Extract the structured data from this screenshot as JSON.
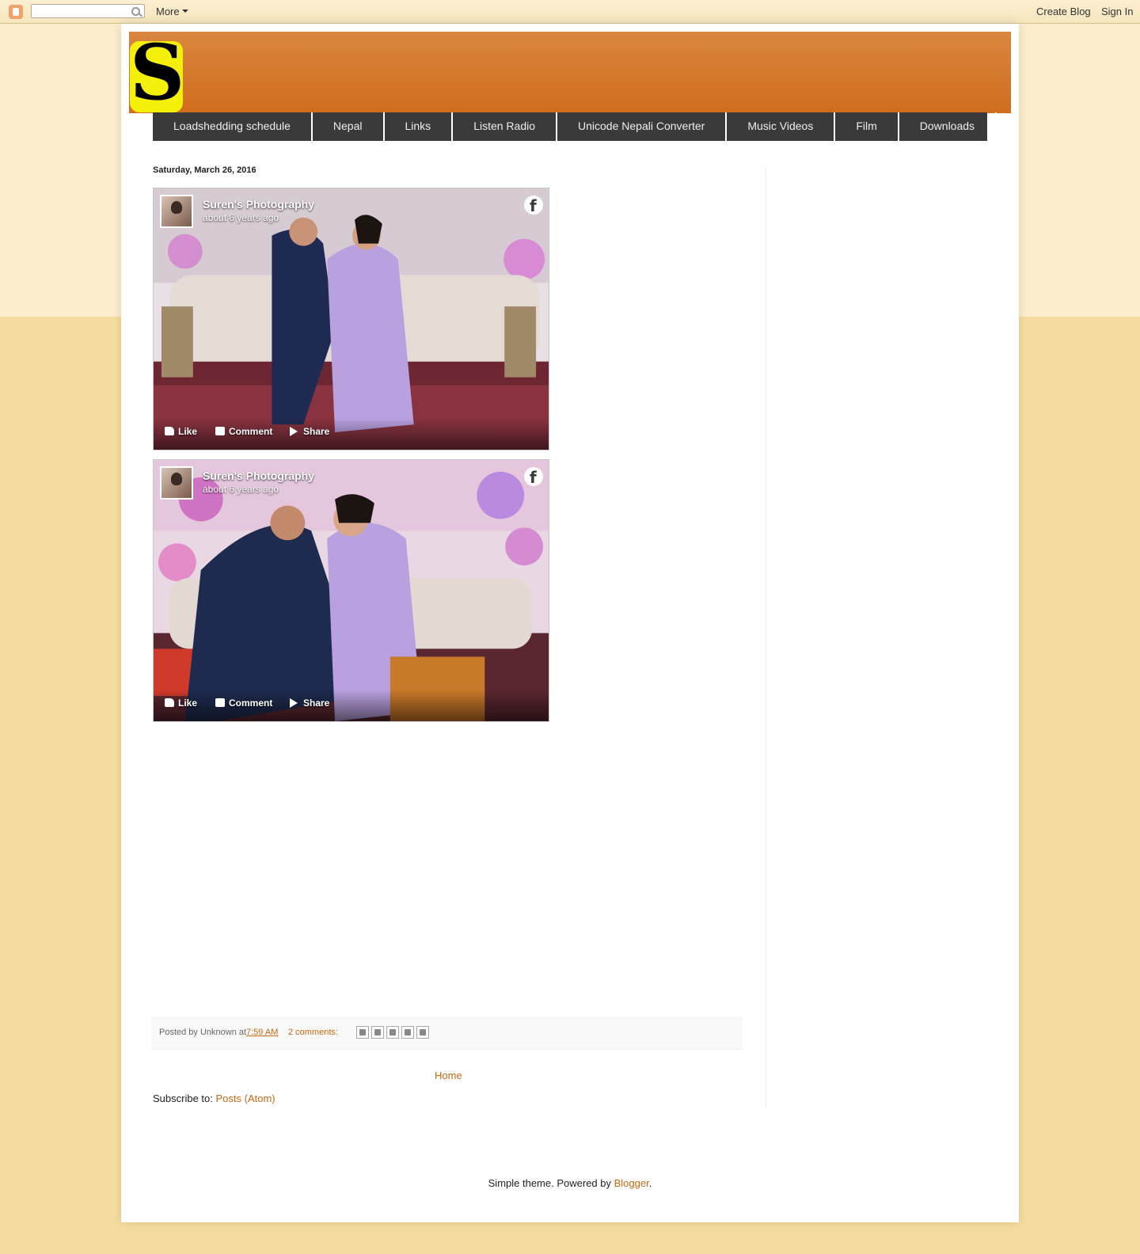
{
  "navbar": {
    "more_label": "More",
    "create_blog_label": "Create Blog",
    "sign_in_label": "Sign In",
    "search_placeholder": ""
  },
  "header": {
    "logo_letter": "S"
  },
  "tabs": [
    {
      "label": "Loadshedding schedule"
    },
    {
      "label": "Nepal"
    },
    {
      "label": "Links"
    },
    {
      "label": "Listen Radio"
    },
    {
      "label": "Unicode Nepali Converter"
    },
    {
      "label": "Music Videos"
    },
    {
      "label": "Film"
    },
    {
      "label": "Downloads"
    }
  ],
  "post": {
    "date": "Saturday, March 26, 2016",
    "embeds": [
      {
        "page_name": "Suren's Photography",
        "time_ago": "about 6 years ago",
        "like": "Like",
        "comment": "Comment",
        "share": "Share"
      },
      {
        "page_name": "Suren's Photography",
        "time_ago": "about 6 years ago",
        "like": "Like",
        "comment": "Comment",
        "share": "Share"
      }
    ],
    "footer": {
      "posted_by": "Posted by Unknown at",
      "time": "7:59 AM",
      "comments": "2 comments:"
    }
  },
  "home_link": "Home",
  "subscribe": {
    "label": "Subscribe to:",
    "link": "Posts (Atom)"
  },
  "attribution": {
    "text": "Simple theme. Powered by",
    "link": "Blogger",
    "suffix": "."
  },
  "colors": {
    "link": "#cc6611",
    "header_orange": "#d06d1d",
    "tab_bg": "#3a3a3a",
    "page_bg": "#f5dc9e"
  }
}
